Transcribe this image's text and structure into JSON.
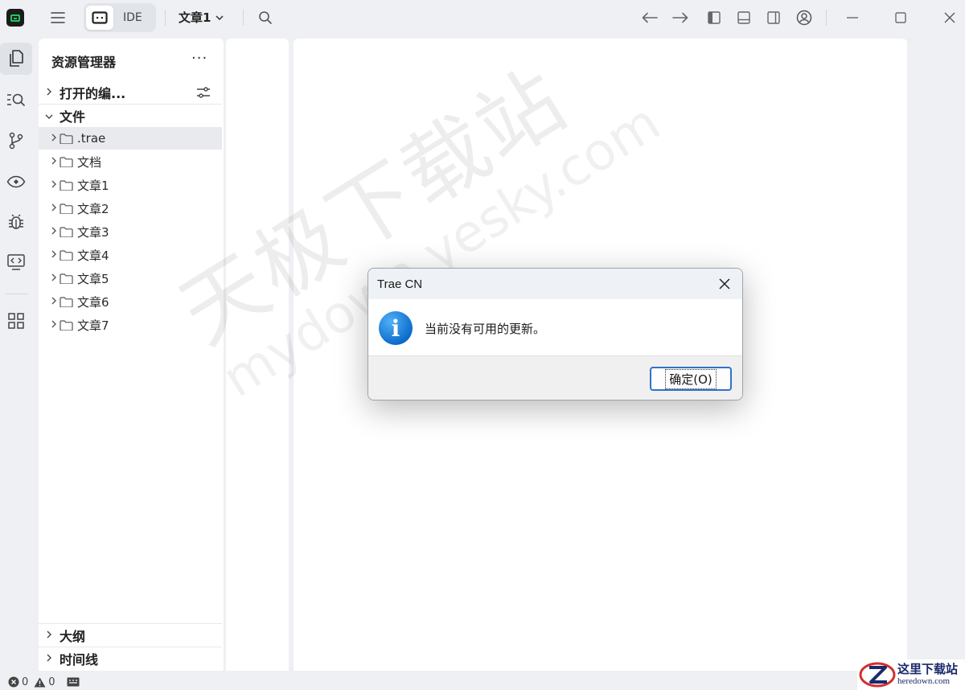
{
  "titlebar": {
    "mode_label": "IDE",
    "project_name": "文章1"
  },
  "sidebar": {
    "title": "资源管理器",
    "more": "···",
    "open_editors": "打开的编...",
    "files_section": "文件",
    "tree": [
      {
        "name": ".trae",
        "selected": true
      },
      {
        "name": "文档"
      },
      {
        "name": "文章1"
      },
      {
        "name": "文章2"
      },
      {
        "name": "文章3"
      },
      {
        "name": "文章4"
      },
      {
        "name": "文章5"
      },
      {
        "name": "文章6"
      },
      {
        "name": "文章7"
      }
    ],
    "outline": "大纲",
    "timeline": "时间线"
  },
  "watermark": {
    "cn": "天极下载站",
    "en": "mydown.yesky.com"
  },
  "dialog": {
    "title": "Trae CN",
    "message": "当前没有可用的更新。",
    "ok_label": "确定(O)"
  },
  "status": {
    "errors": "0",
    "warnings": "0"
  },
  "site_logo": {
    "cn": "这里下载站",
    "en": "heredown.com"
  },
  "colors": {
    "accent": "#2f73c8",
    "logo_green": "#22c55e",
    "info_blue": "#0a68c9"
  }
}
